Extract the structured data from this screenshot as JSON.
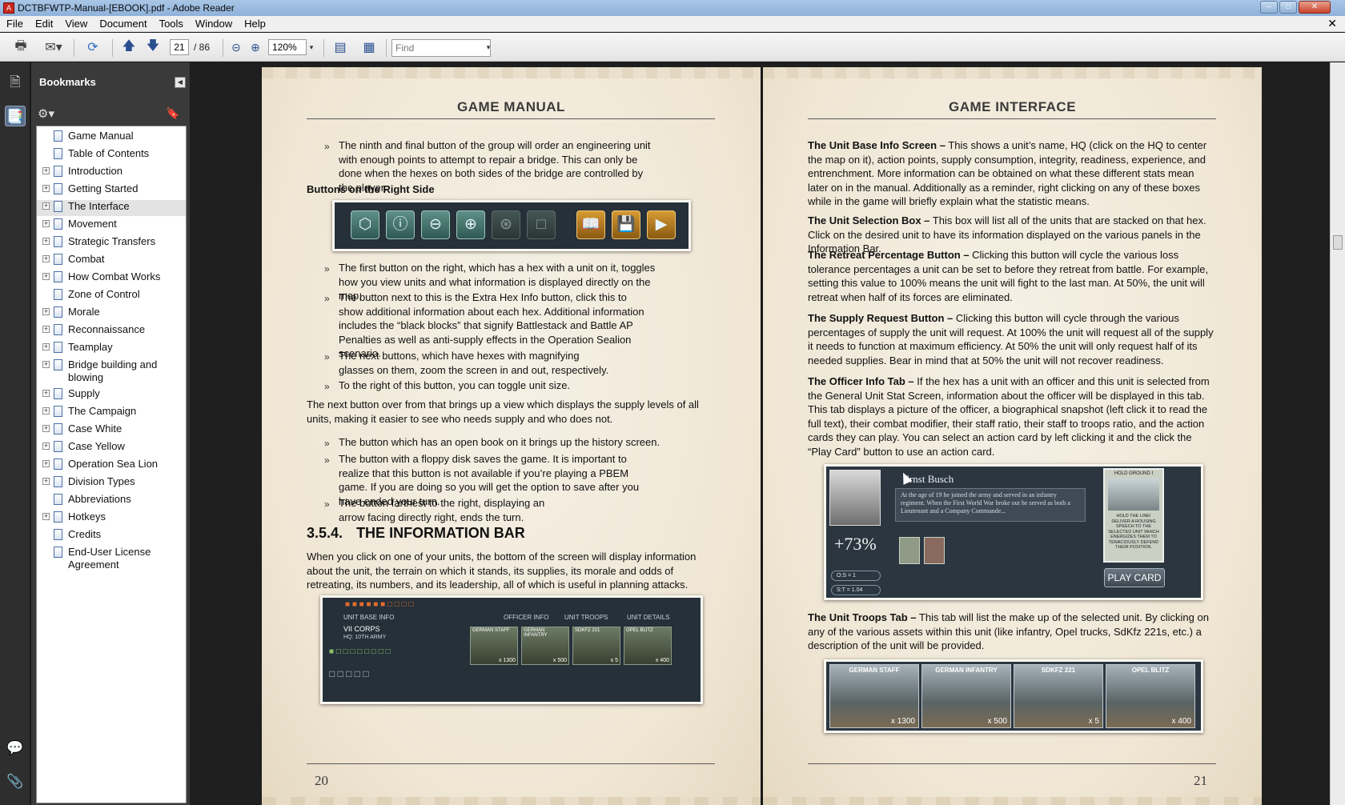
{
  "window": {
    "title": "DCTBFWTP-Manual-[EBOOK].pdf - Adobe Reader",
    "app_icon": "adobe-reader-icon"
  },
  "menu": [
    "File",
    "Edit",
    "View",
    "Document",
    "Tools",
    "Window",
    "Help"
  ],
  "toolbar": {
    "current_page": "21",
    "total_pages": "/ 86",
    "zoom": "120%",
    "find_placeholder": "Find"
  },
  "bookmarks": {
    "title": "Bookmarks",
    "items": [
      {
        "label": "Game Manual",
        "expandable": false
      },
      {
        "label": "Table of Contents",
        "expandable": false
      },
      {
        "label": "Introduction",
        "expandable": true
      },
      {
        "label": "Getting Started",
        "expandable": true
      },
      {
        "label": "The Interface",
        "expandable": true,
        "selected": true
      },
      {
        "label": "Movement",
        "expandable": true
      },
      {
        "label": "Strategic Transfers",
        "expandable": true
      },
      {
        "label": "Combat",
        "expandable": true
      },
      {
        "label": "How Combat Works",
        "expandable": true
      },
      {
        "label": "Zone of Control",
        "expandable": false
      },
      {
        "label": "Morale",
        "expandable": true
      },
      {
        "label": "Reconnaissance",
        "expandable": true
      },
      {
        "label": "Teamplay",
        "expandable": true
      },
      {
        "label": "Bridge building and blowing",
        "expandable": true
      },
      {
        "label": "Supply",
        "expandable": true
      },
      {
        "label": "The Campaign",
        "expandable": true
      },
      {
        "label": "Case White",
        "expandable": true
      },
      {
        "label": "Case Yellow",
        "expandable": true
      },
      {
        "label": "Operation Sea Lion",
        "expandable": true
      },
      {
        "label": "Division Types",
        "expandable": true
      },
      {
        "label": "Abbreviations",
        "expandable": false
      },
      {
        "label": "Hotkeys",
        "expandable": true
      },
      {
        "label": "Credits",
        "expandable": false
      },
      {
        "label": "End-User License Agreement",
        "expandable": false
      }
    ]
  },
  "left_page": {
    "header": "GAME MANUAL",
    "bullet_1": "The ninth and final button of the group will order an engineering unit with enough points to attempt to repair a bridge. This can only be done when the hexes on both sides of the bridge are controlled by the player.",
    "subheading": "Buttons on the Right Side",
    "bullet_2": "The first button on the right, which has a hex with a unit on it, toggles how you view units and what information is displayed directly on the map.",
    "bullet_3": "The button next to this is the Extra Hex Info button, click this to show additional information about each hex. Additional information includes the “black blocks” that signify Battlestack and Battle AP Penalties as well as anti-supply effects in the Operation Sealion scenario.",
    "bullet_4": "The next buttons, which have hexes with magnifying glasses on them, zoom the screen in and out, respectively.",
    "bullet_5": "To the right of this button, you can toggle unit size.",
    "para_1": "The next button over from that brings up a view which displays the supply levels of all units, making it easier to see who needs supply and who does not.",
    "bullet_6": "The button which has an open book on it brings up the history screen.",
    "bullet_7": "The button with a floppy disk saves the game. It is important to realize that this button is not available if you’re playing a PBEM game. If you are doing so you will get the option to save after you have ended your turn.",
    "bullet_8": "The button farthest to the right, displaying an arrow facing directly right, ends the turn.",
    "section_number": "3.5.4.",
    "section_title": "THE INFORMATION BAR",
    "para_2": "When you click on one of your units, the bottom of the screen will display information about the unit, the terrain on which it stands, its supplies, its morale and odds of retreating, its numbers, and its leadership, all of which is useful in planning attacks.",
    "info_bar": {
      "tab_base": "UNIT BASE INFO",
      "tab_officer": "OFFICER INFO",
      "tab_troops": "UNIT TROOPS",
      "tab_details": "UNIT DETAILS",
      "corps": "VII CORPS",
      "army": "HQ: 10TH ARMY",
      "units": [
        {
          "label": "GERMAN STAFF",
          "count": "x 1300"
        },
        {
          "label": "GERMAN INFANTRY",
          "count": "x 500"
        },
        {
          "label": "SDKFZ 221",
          "count": "x 5"
        },
        {
          "label": "OPEL BLITZ",
          "count": "x 400"
        }
      ]
    },
    "page_number": "20"
  },
  "right_page": {
    "header": "GAME INTERFACE",
    "p1_bold": "The Unit Base Info Screen –",
    "p1": " This shows a unit’s name, HQ (click on the HQ to center the map on it), action points, supply consumption, integrity, readiness, experience, and entrenchment. More information can be obtained on what these different stats mean later on in the manual. Additionally as a reminder, right clicking on any of these boxes while in the game will briefly explain what the statistic means.",
    "p2_bold": "The Unit Selection Box –",
    "p2": " This box will list all of the units that are stacked on that hex. Click on the desired unit to have its information displayed on the various panels in the Information Bar.",
    "p3_bold": "The Retreat Percentage Button –",
    "p3": " Clicking this button will cycle the various loss tolerance percentages a unit can be set to before they retreat from battle. For example, setting this value to 100% means the unit will fight to the last man. At 50%, the unit will retreat when half of its forces are eliminated.",
    "p4_bold": "The Supply Request Button –",
    "p4": " Clicking this button will cycle through the various percentages of supply the unit will request. At 100% the unit will request all of the supply it needs to function at maximum efficiency. At 50% the unit will only request half of its needed supplies. Bear in mind that at 50% the unit will not recover readiness.",
    "p5_bold": "The Officer Info Tab –",
    "p5": " If the hex has a unit with an officer and this unit is selected from the General Unit Stat Screen, information about the officer will be displayed in this tab. This tab displays a picture of the officer, a biographical snapshot (left click it to read the full text), their combat modifier, their staff ratio, their staff to troops ratio, and the action cards they can play. You can select an action card by left clicking it and the click the “Play Card” button to use an action card.",
    "officer": {
      "name": "Ernst Busch",
      "bio": "At the age of 19 he joined the army and served in an infantry regiment. When the First World War broke out he served as both a Lieutenant and a Company Commande...",
      "modifier": "+73%",
      "stat_os": "O:S = 1",
      "stat_st": "S:T = 1.04",
      "card_title": "HOLD GROUND I",
      "card_text": "HOLD THE LINE! DELIVER A ROUSING SPEECH TO THE SELECTED UNIT WHICH ENERGIZES THEM TO TENACIOUSLY DEFEND THEIR POSITION.",
      "play_card": "PLAY CARD"
    },
    "p6_bold": "The Unit Troops Tab –",
    "p6": " This tab will list the make up of the selected unit. By clicking on any of the various assets within this unit (like infantry, Opel trucks, SdKfz 221s, etc.) a description of the unit will be provided.",
    "troops": [
      {
        "label": "GERMAN STAFF",
        "count": "x 1300"
      },
      {
        "label": "GERMAN INFANTRY",
        "count": "x 500"
      },
      {
        "label": "SDKFZ 221",
        "count": "x 5"
      },
      {
        "label": "OPEL BLITZ",
        "count": "x 400"
      }
    ],
    "page_number": "21"
  }
}
